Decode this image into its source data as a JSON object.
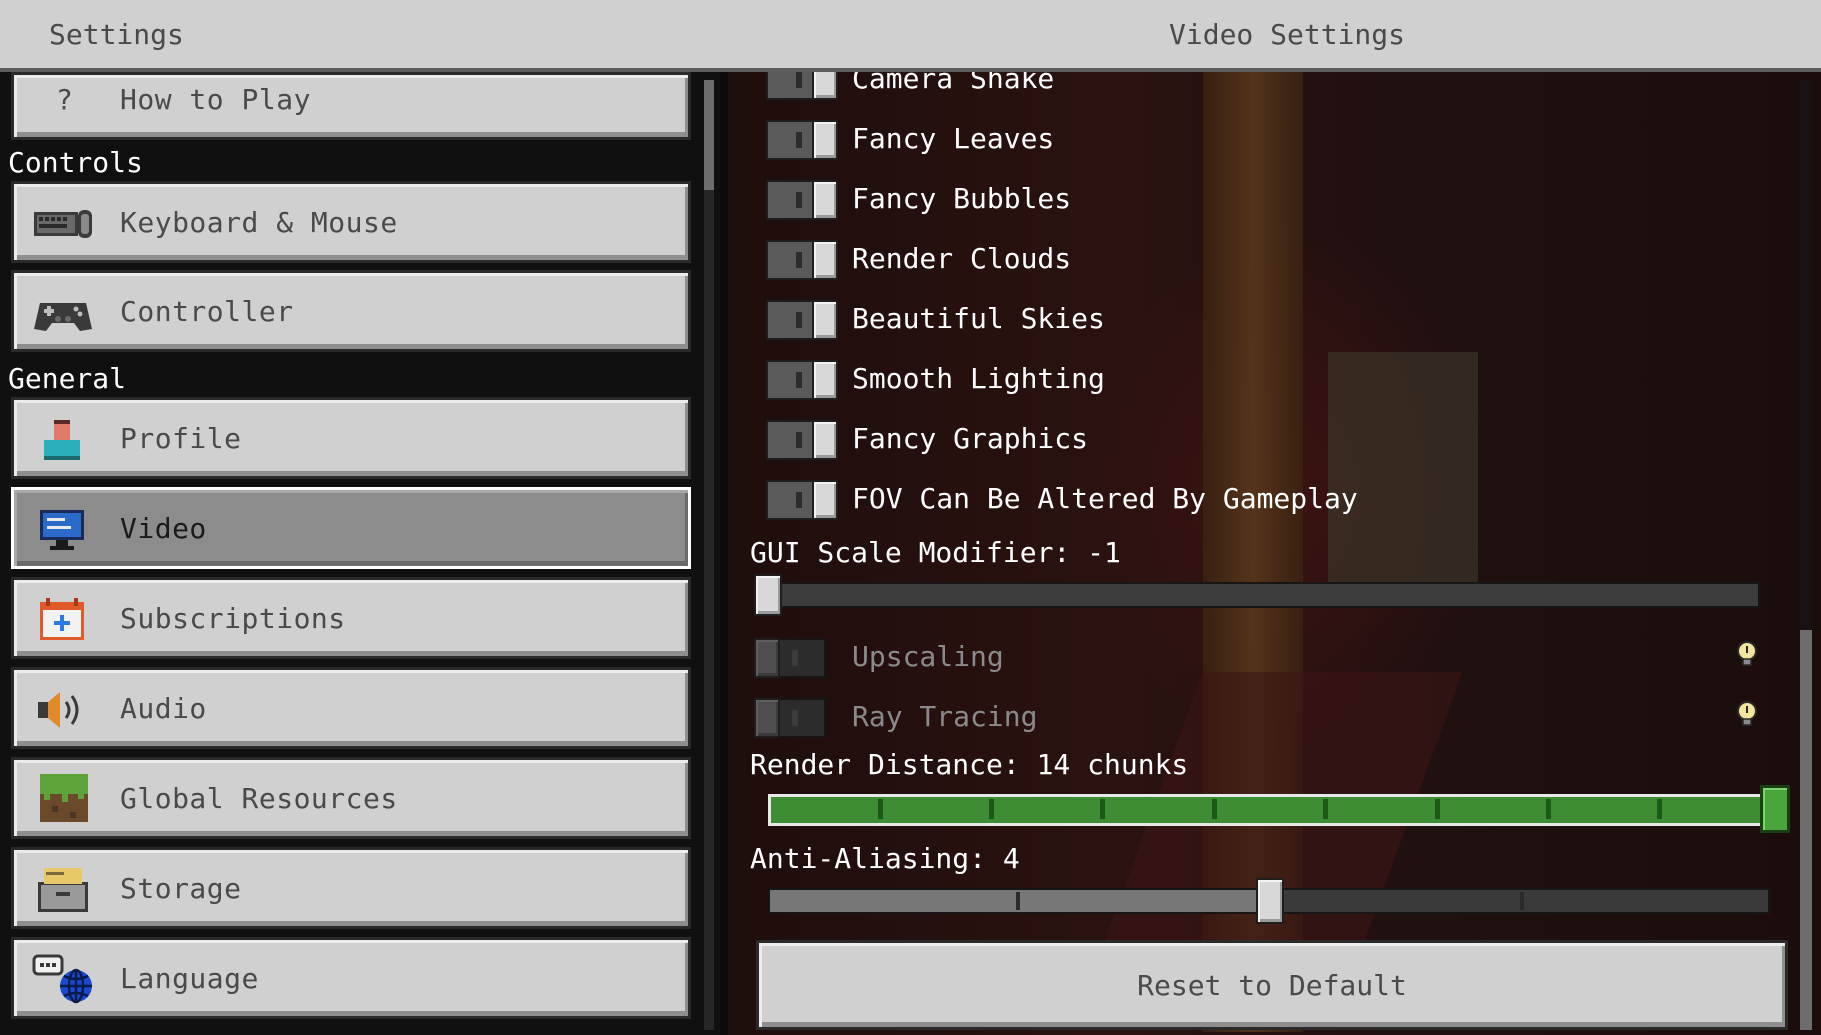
{
  "title_bar": {
    "left_title": "Settings",
    "right_title": "Video Settings"
  },
  "sidebar": {
    "partial_item": {
      "icon": "question-mark-icon",
      "icon_glyph": "?",
      "label": "How to Play"
    },
    "sections": [
      {
        "header": "Controls",
        "items": [
          {
            "icon": "keyboard-mouse-icon",
            "label": "Keyboard & Mouse"
          },
          {
            "icon": "controller-icon",
            "label": "Controller"
          }
        ]
      },
      {
        "header": "General",
        "items": [
          {
            "icon": "profile-icon",
            "label": "Profile"
          },
          {
            "icon": "video-monitor-icon",
            "label": "Video",
            "selected": true
          },
          {
            "icon": "subscriptions-icon",
            "label": "Subscriptions"
          },
          {
            "icon": "audio-speaker-icon",
            "label": "Audio"
          },
          {
            "icon": "global-resources-icon",
            "label": "Global Resources"
          },
          {
            "icon": "storage-icon",
            "label": "Storage"
          },
          {
            "icon": "language-icon",
            "label": "Language"
          }
        ]
      }
    ]
  },
  "video_settings": {
    "toggles": [
      {
        "label": "Camera Shake",
        "on": true,
        "partial": true
      },
      {
        "label": "Fancy Leaves",
        "on": true
      },
      {
        "label": "Fancy Bubbles",
        "on": true
      },
      {
        "label": "Render Clouds",
        "on": true
      },
      {
        "label": "Beautiful Skies",
        "on": true
      },
      {
        "label": "Smooth Lighting",
        "on": true
      },
      {
        "label": "Fancy Graphics",
        "on": true
      },
      {
        "label": "FOV Can Be Altered By Gameplay",
        "on": true
      }
    ],
    "gui_scale": {
      "label": "GUI Scale Modifier: -1",
      "value": -1
    },
    "disabled_toggles": [
      {
        "label": "Upscaling",
        "on": false,
        "info_icon": "info-bulb-icon"
      },
      {
        "label": "Ray Tracing",
        "on": false,
        "info_icon": "info-bulb-icon"
      }
    ],
    "render_distance": {
      "label": "Render Distance: 14 chunks",
      "value": 14
    },
    "anti_aliasing": {
      "label": "Anti-Aliasing: 4",
      "value": 4
    },
    "reset_button": "Reset to Default"
  },
  "colors": {
    "button_bg": "#d0d0d0",
    "selected_bg": "#8c8c8c",
    "slider_green": "#3e8d35",
    "text_white": "#ffffff"
  }
}
